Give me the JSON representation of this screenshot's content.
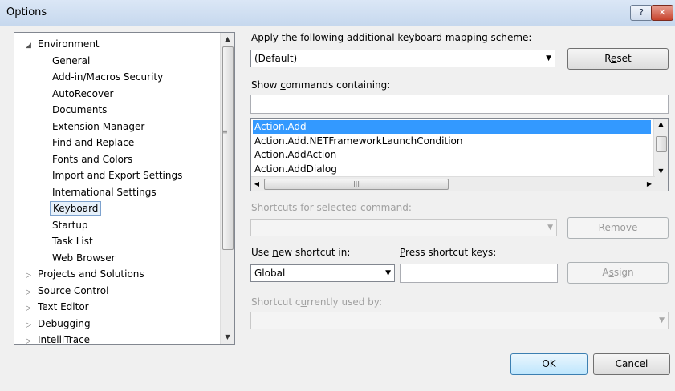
{
  "window": {
    "title": "Options",
    "help_glyph": "?",
    "close_glyph": "✕"
  },
  "tree": {
    "items": [
      {
        "label": "Environment",
        "arrow": "◢",
        "level": 0
      },
      {
        "label": "General",
        "level": 1
      },
      {
        "label": "Add-in/Macros Security",
        "level": 1
      },
      {
        "label": "AutoRecover",
        "level": 1
      },
      {
        "label": "Documents",
        "level": 1
      },
      {
        "label": "Extension Manager",
        "level": 1
      },
      {
        "label": "Find and Replace",
        "level": 1
      },
      {
        "label": "Fonts and Colors",
        "level": 1
      },
      {
        "label": "Import and Export Settings",
        "level": 1
      },
      {
        "label": "International Settings",
        "level": 1
      },
      {
        "label": "Keyboard",
        "level": 1,
        "selected": true
      },
      {
        "label": "Startup",
        "level": 1
      },
      {
        "label": "Task List",
        "level": 1
      },
      {
        "label": "Web Browser",
        "level": 1
      },
      {
        "label": "Projects and Solutions",
        "arrow": "▷",
        "level": 0
      },
      {
        "label": "Source Control",
        "arrow": "▷",
        "level": 0
      },
      {
        "label": "Text Editor",
        "arrow": "▷",
        "level": 0
      },
      {
        "label": "Debugging",
        "arrow": "▷",
        "level": 0
      },
      {
        "label": "IntelliTrace",
        "arrow": "▷",
        "level": 0
      }
    ]
  },
  "mapping": {
    "label_pre": "Apply the following additional keyboard ",
    "label_u": "m",
    "label_post": "apping scheme:",
    "value": "(Default)",
    "reset_pre": "R",
    "reset_u": "e",
    "reset_post": "set"
  },
  "commands": {
    "label_pre": "Show ",
    "label_u": "c",
    "label_post": "ommands containing:",
    "filter_value": "",
    "items": [
      "Action.Add",
      "Action.Add.NETFrameworkLaunchCondition",
      "Action.AddAction",
      "Action.AddDialog"
    ],
    "selected_index": 0
  },
  "shortcuts": {
    "label_pre": "Shor",
    "label_u": "t",
    "label_post": "cuts for selected command:",
    "remove_u": "R",
    "remove_post": "emove"
  },
  "new_shortcut": {
    "use_label_pre": "Use ",
    "use_label_u": "n",
    "use_label_post": "ew shortcut in:",
    "scope_value": "Global",
    "press_label_u": "P",
    "press_label_post": "ress shortcut keys:",
    "keys_value": "",
    "assign_pre": "A",
    "assign_u": "s",
    "assign_post": "sign"
  },
  "used_by": {
    "label_pre": "Shortcut c",
    "label_u": "u",
    "label_post": "rrently used by:"
  },
  "footer": {
    "ok_label": "OK",
    "cancel_label": "Cancel"
  },
  "colors": {
    "selection": "#3399ff",
    "tree_selection_border": "#7da2ce",
    "disabled_text": "#a0a0a0"
  }
}
